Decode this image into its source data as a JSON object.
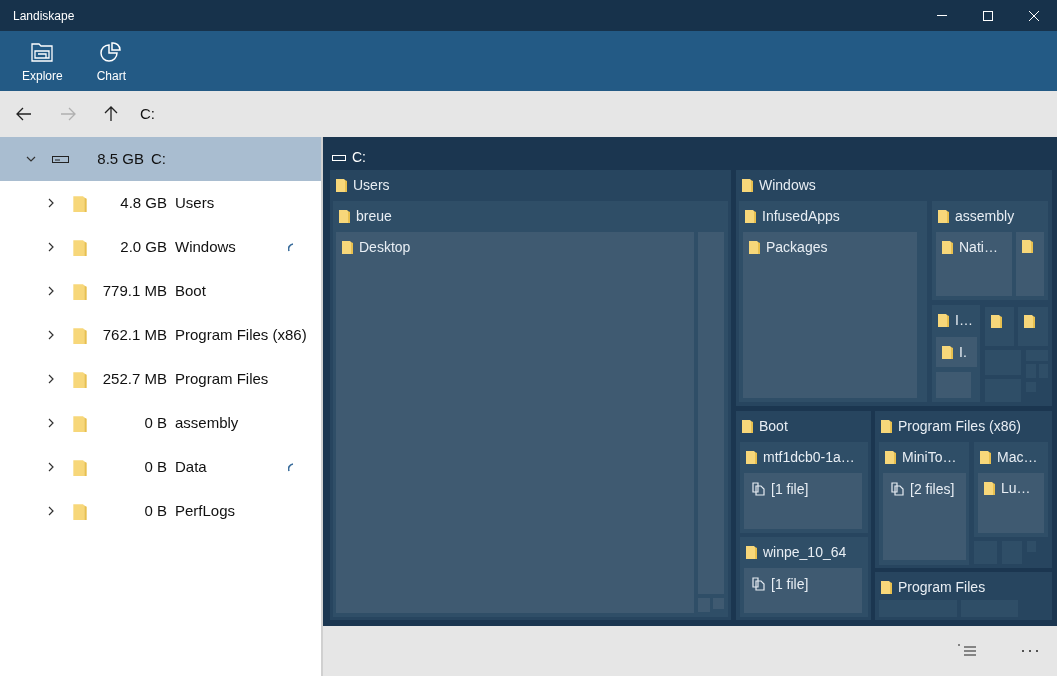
{
  "window": {
    "title": "Landiskape"
  },
  "ribbon": [
    {
      "kind": "explore",
      "label": "Explore"
    },
    {
      "kind": "chart",
      "label": "Chart"
    }
  ],
  "nav": {
    "back_disabled": false,
    "forward_disabled": true,
    "up_disabled": false,
    "path": "C:"
  },
  "tree": {
    "size": "8.5 GB",
    "name": "C:",
    "expanded": true,
    "selected": true,
    "children": [
      {
        "size": "4.8 GB",
        "name": "Users",
        "expanded": false,
        "loading": false
      },
      {
        "size": "2.0 GB",
        "name": "Windows",
        "expanded": false,
        "loading": true
      },
      {
        "size": "779.1 MB",
        "name": "Boot",
        "expanded": false,
        "loading": false
      },
      {
        "size": "762.1 MB",
        "name": "Program Files (x86)",
        "expanded": false,
        "loading": false
      },
      {
        "size": "252.7 MB",
        "name": "Program Files",
        "expanded": false,
        "loading": false
      },
      {
        "size": "0 B",
        "name": "assembly",
        "expanded": false,
        "loading": false
      },
      {
        "size": "0 B",
        "name": "Data",
        "expanded": false,
        "loading": true
      },
      {
        "size": "0 B",
        "name": "PerfLogs",
        "expanded": false,
        "loading": false
      }
    ]
  },
  "treemap": {
    "title": "C:",
    "tiles": [
      {
        "kind": "folder",
        "label": "Users",
        "children": [
          {
            "kind": "folder",
            "label": "breue",
            "children": [
              {
                "kind": "folder",
                "label": "Desktop"
              },
              {
                "kind": "blank"
              },
              {
                "kind": "blank"
              },
              {
                "kind": "blank"
              }
            ]
          }
        ]
      },
      {
        "kind": "folder",
        "label": "Windows",
        "children": [
          {
            "kind": "folder",
            "label": "InfusedApps",
            "children": [
              {
                "kind": "folder",
                "label": "Packages"
              }
            ]
          },
          {
            "kind": "folder",
            "label": "assembly",
            "children": [
              {
                "kind": "folder",
                "label": "Nati…"
              },
              {
                "kind": "folder"
              }
            ]
          },
          {
            "kind": "folder",
            "label": "I…",
            "children": [
              {
                "kind": "folder",
                "label": "I."
              },
              {
                "kind": "blank"
              }
            ]
          },
          {
            "kind": "folder"
          },
          {
            "kind": "folder"
          },
          {
            "kind": "blank"
          },
          {
            "kind": "blank"
          },
          {
            "kind": "blank"
          },
          {
            "kind": "blank"
          },
          {
            "kind": "blank"
          },
          {
            "kind": "blank"
          }
        ]
      },
      {
        "kind": "folder",
        "label": "Boot",
        "children": [
          {
            "kind": "folder",
            "label": "mtf1dcb0-1a…",
            "children": [
              {
                "kind": "files",
                "label": "[1 file]"
              }
            ]
          },
          {
            "kind": "folder",
            "label": "winpe_10_64",
            "children": [
              {
                "kind": "files",
                "label": "[1 file]"
              }
            ]
          }
        ]
      },
      {
        "kind": "folder",
        "label": "Program Files (x86)",
        "children": [
          {
            "kind": "folder",
            "label": "MiniTo…",
            "children": [
              {
                "kind": "files",
                "label": "[2 files]"
              }
            ]
          },
          {
            "kind": "folder",
            "label": "Mac…",
            "children": [
              {
                "kind": "folder",
                "label": "Lu…"
              }
            ]
          },
          {
            "kind": "blank"
          },
          {
            "kind": "blank"
          },
          {
            "kind": "blank"
          }
        ]
      },
      {
        "kind": "folder",
        "label": "Program Files",
        "children": [
          {
            "kind": "blank"
          },
          {
            "kind": "blank"
          }
        ]
      }
    ]
  }
}
